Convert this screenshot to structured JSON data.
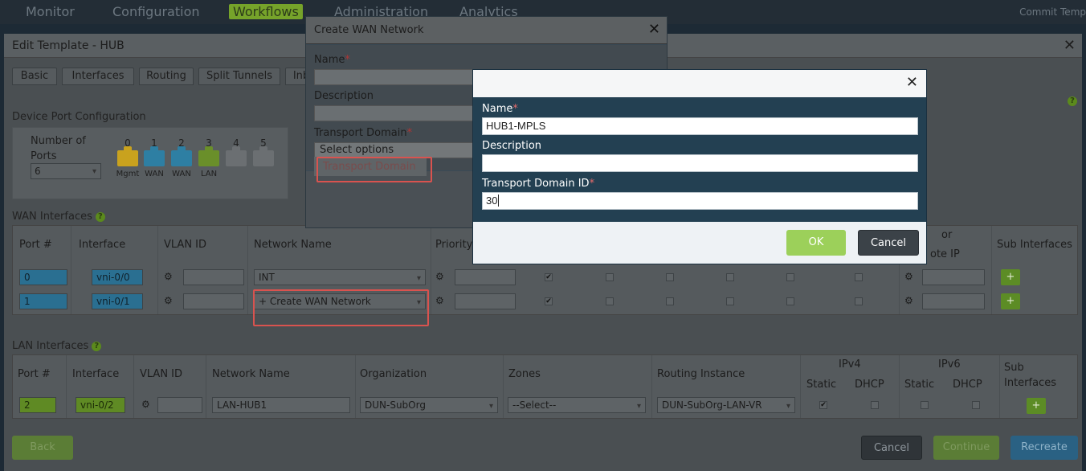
{
  "topnav": {
    "items": [
      "Monitor",
      "Configuration",
      "Workflows",
      "Administration",
      "Analytics"
    ],
    "active": "Workflows",
    "commit": "Commit Temp"
  },
  "edit_template": {
    "title": "Edit Template - HUB",
    "tabs": [
      "Basic",
      "Interfaces",
      "Routing",
      "Split Tunnels",
      "Inb"
    ],
    "device_port_title": "Device Port Configuration",
    "num_ports_label": "Number of Ports",
    "num_ports_value": "6",
    "ports": [
      {
        "num": "0",
        "label": "Mgmt",
        "color": "#c9a21e"
      },
      {
        "num": "1",
        "label": "WAN",
        "color": "#2e7fa3"
      },
      {
        "num": "2",
        "label": "WAN",
        "color": "#2e7fa3"
      },
      {
        "num": "3",
        "label": "LAN",
        "color": "#6a8f2a"
      },
      {
        "num": "4",
        "label": "",
        "color": "#6b6f72"
      },
      {
        "num": "5",
        "label": "",
        "color": "#6b6f72"
      }
    ],
    "wan": {
      "title": "WAN Interfaces",
      "headers": {
        "port": "Port #",
        "interface": "Interface",
        "vlan": "VLAN ID",
        "network": "Network Name",
        "priority": "Priority",
        "or": "or",
        "remote_ip": "ote IP",
        "sub": "Sub Interfaces"
      },
      "rows": [
        {
          "port": "0",
          "interface": "vni-0/0",
          "network": "INT"
        },
        {
          "port": "1",
          "interface": "vni-0/1",
          "network": "+ Create WAN Network"
        }
      ]
    },
    "lan": {
      "title": "LAN Interfaces",
      "headers": {
        "port": "Port #",
        "interface": "Interface",
        "vlan": "VLAN ID",
        "network": "Network Name",
        "org": "Organization",
        "zones": "Zones",
        "routing": "Routing Instance",
        "ipv4": "IPv4",
        "ipv6": "IPv6",
        "static": "Static",
        "dhcp": "DHCP",
        "sub": "Sub Interfaces"
      },
      "row": {
        "port": "2",
        "interface": "vni-0/2",
        "network": "LAN-HUB1",
        "org": "DUN-SubOrg",
        "zones": "--Select--",
        "routing": "DUN-SubOrg-LAN-VR"
      }
    },
    "buttons": {
      "back": "Back",
      "cancel": "Cancel",
      "continue": "Continue",
      "recreate": "Recreate"
    }
  },
  "wan_modal": {
    "title": "Create WAN Network",
    "name_label": "Name",
    "description_label": "Description",
    "transport_label": "Transport Domain",
    "select_placeholder": "Select options",
    "transport_link": "Transport Domain"
  },
  "td_modal": {
    "name_label": "Name",
    "name_value": "HUB1-MPLS",
    "description_label": "Description",
    "description_value": "",
    "id_label": "Transport Domain ID",
    "id_value": "30",
    "ok": "OK",
    "cancel": "Cancel"
  }
}
